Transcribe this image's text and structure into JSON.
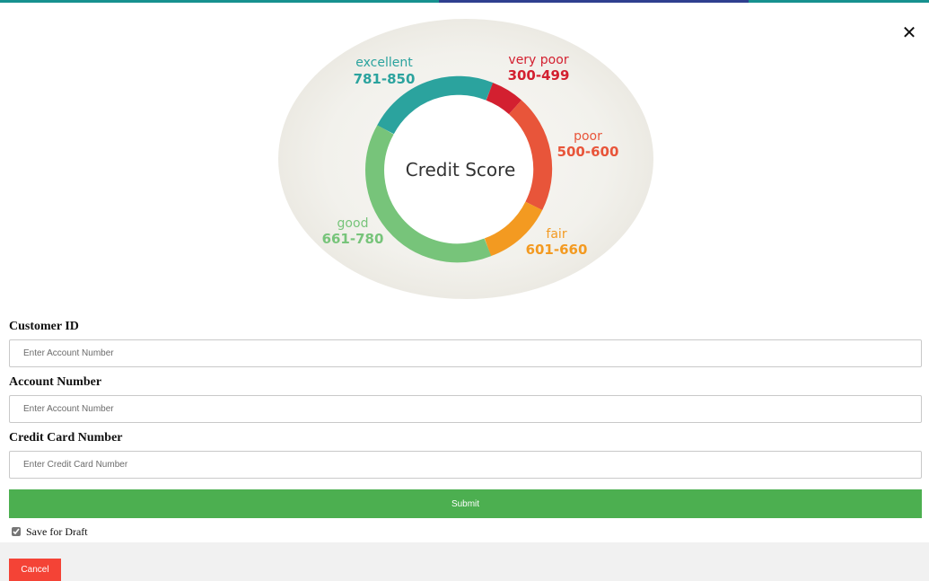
{
  "modal": {
    "close_label": "✕"
  },
  "hero": {
    "center_title": "Credit Score",
    "ranges": [
      {
        "name": "excellent",
        "range": "781-850",
        "color": "#2ba39e"
      },
      {
        "name": "very poor",
        "range": "300-499",
        "color": "#d32030"
      },
      {
        "name": "poor",
        "range": "500-600",
        "color": "#e8553a"
      },
      {
        "name": "fair",
        "range": "601-660",
        "color": "#f39a21"
      },
      {
        "name": "good",
        "range": "661-780",
        "color": "#77c47a"
      }
    ]
  },
  "form": {
    "customer_id": {
      "label": "Customer ID",
      "placeholder": "Enter Account Number"
    },
    "account_number": {
      "label": "Account Number",
      "placeholder": "Enter Account Number"
    },
    "credit_card": {
      "label": "Credit Card Number",
      "placeholder": "Enter Credit Card Number"
    },
    "submit_label": "Submit",
    "draft": {
      "label": "Save for Draft",
      "checked": true
    }
  },
  "footer": {
    "cancel_label": "Cancel"
  },
  "colors": {
    "top_bar": "#17918f",
    "top_bar_accent": "#2f3f8f",
    "submit": "#4caf50",
    "cancel": "#f44336",
    "footer_bg": "#f1f1f1"
  }
}
